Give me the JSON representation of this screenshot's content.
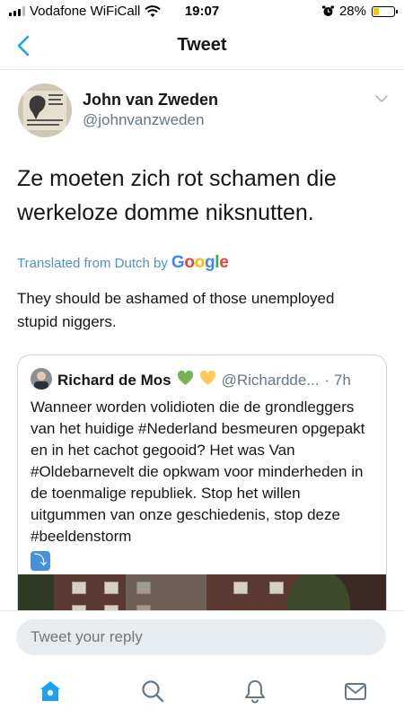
{
  "status_bar": {
    "carrier": "Vodafone WiFiCall",
    "time": "19:07",
    "battery": "28%",
    "battery_level": 0.28,
    "battery_color": "#f5c400"
  },
  "header": {
    "title": "Tweet",
    "back_icon": "chevron-left-icon"
  },
  "tweet": {
    "author_name": "John van Zweden",
    "author_handle": "@johnvanzweden",
    "text": "Ze moeten zich rot schamen die werkeloze domme niksnutten.",
    "translated_from": "Translated from Dutch by",
    "translator": [
      "G",
      "o",
      "o",
      "g",
      "l",
      "e"
    ],
    "translation": "They should be ashamed of those unemployed stupid niggers."
  },
  "quote": {
    "author_name": "Richard de Mos",
    "author_handle": "@Richardde...",
    "time": "· 7h",
    "text": "Wanneer worden volidioten die de grondleggers van het huidige #Nederland besmeuren opgepakt en in het cachot gegooid? Het was Van #Oldebarnevelt die opkwam voor minderheden in de toenmalige republiek. Stop het willen uitgummen van onze geschiedenis, stop deze #beeldenstorm",
    "emoji": "⤵",
    "hearts": [
      "green-heart",
      "yellow-heart"
    ]
  },
  "reply": {
    "placeholder": "Tweet your reply"
  },
  "tabs": [
    "home-icon",
    "search-icon",
    "notifications-icon",
    "messages-icon"
  ],
  "colors": {
    "accent": "#1da1f2",
    "translated_link": "#4f93c6",
    "secondary_text": "#657786"
  }
}
